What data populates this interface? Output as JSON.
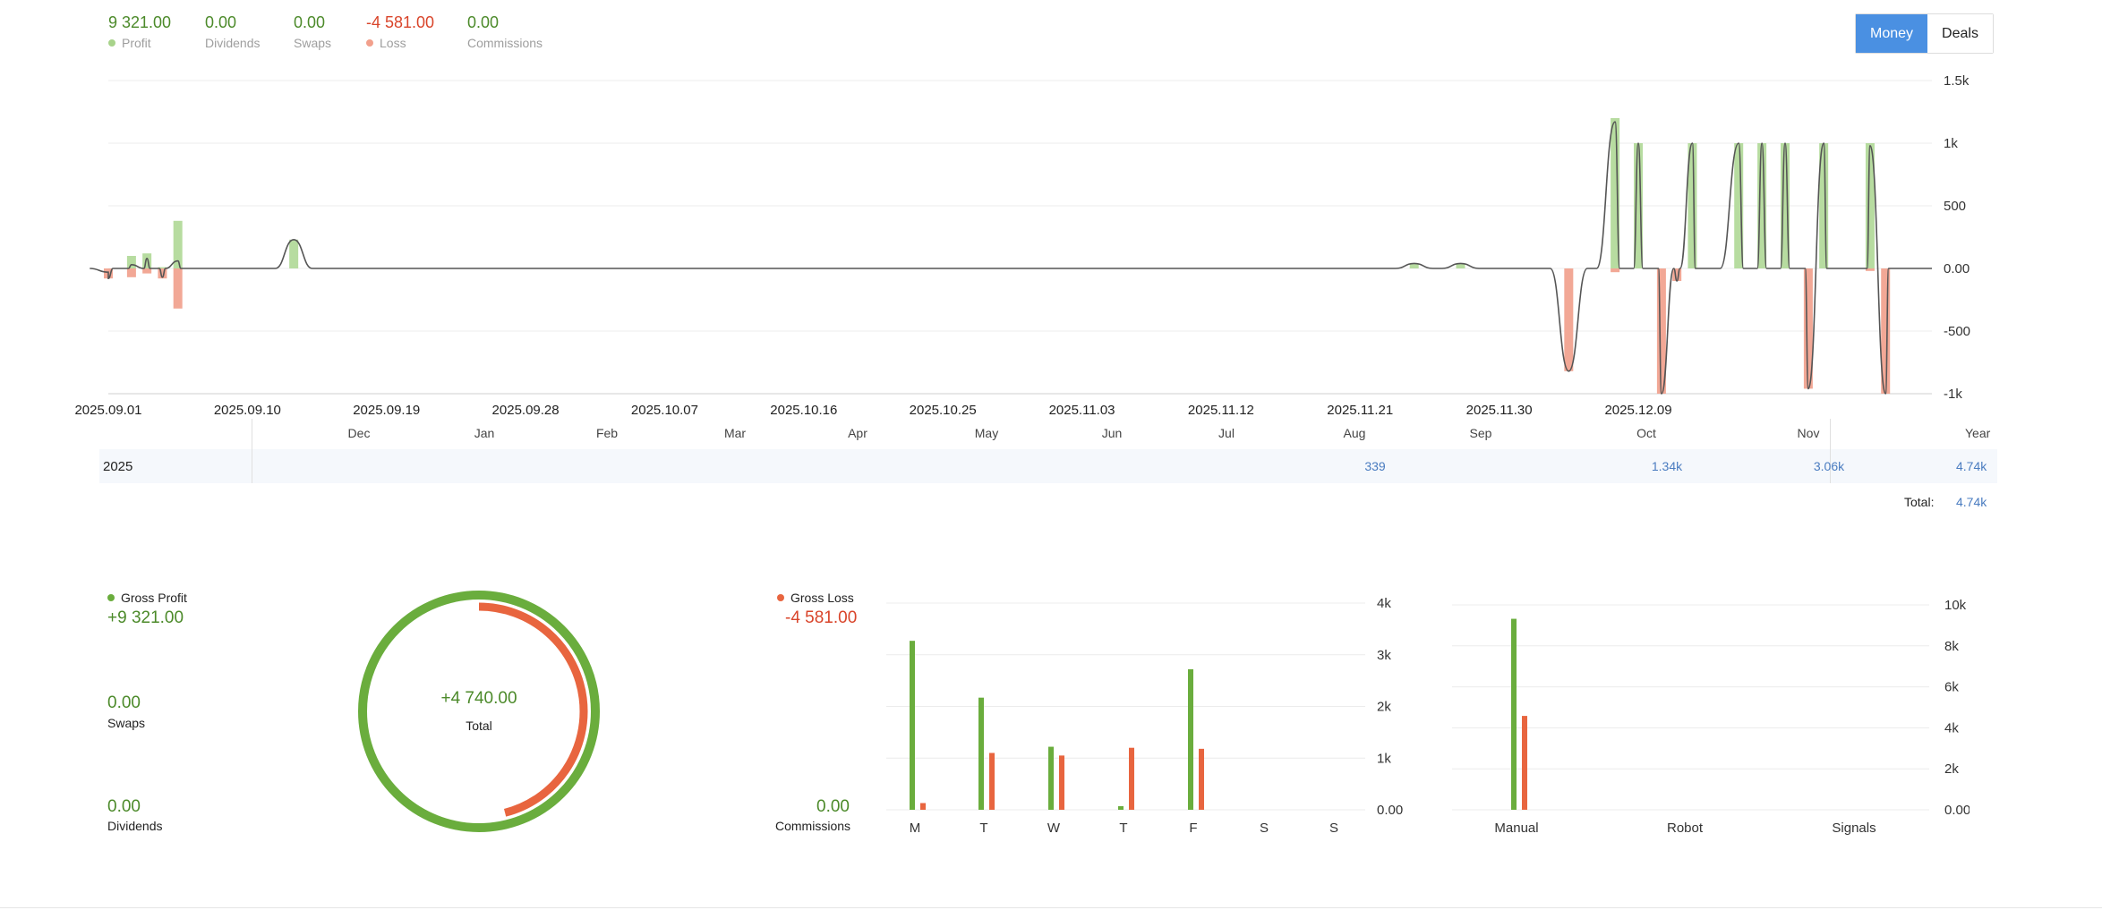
{
  "summary": [
    {
      "key": "profit",
      "value": "9 321.00",
      "label": "Profit",
      "dot": "#a8d38b",
      "color": "green"
    },
    {
      "key": "dividends",
      "value": "0.00",
      "label": "Dividends",
      "dot": "",
      "color": "green"
    },
    {
      "key": "swaps",
      "value": "0.00",
      "label": "Swaps",
      "dot": "",
      "color": "green"
    },
    {
      "key": "loss",
      "value": "-4 581.00",
      "label": "Loss",
      "dot": "#f2a08c",
      "color": "red"
    },
    {
      "key": "commissions",
      "value": "0.00",
      "label": "Commissions",
      "dot": "",
      "color": "green"
    }
  ],
  "toggle": {
    "money": "Money",
    "deals": "Deals"
  },
  "main_chart": {
    "yticks": [
      "1.5k",
      "1k",
      "500",
      "0.00",
      "-500",
      "-1k"
    ],
    "xticks": [
      "2025.09.01",
      "2025.09.10",
      "2025.09.19",
      "2025.09.28",
      "2025.10.07",
      "2025.10.16",
      "2025.10.25",
      "2025.11.03",
      "2025.11.12",
      "2025.11.21",
      "2025.11.30",
      "2025.12.09"
    ]
  },
  "months_table": {
    "headers": [
      "Dec",
      "Jan",
      "Feb",
      "Mar",
      "Apr",
      "May",
      "Jun",
      "Jul",
      "Aug",
      "Sep",
      "Oct",
      "Nov"
    ],
    "year_header": "Year",
    "row_label": "2025",
    "values": {
      "Aug": "339",
      "Oct": "1.34k",
      "Nov": "3.06k"
    },
    "year_value": "4.74k",
    "total_label": "Total:",
    "total_value": "4.74k"
  },
  "bottom": {
    "gross_profit_label": "Gross Profit",
    "gross_profit_value": "+9 321.00",
    "swaps_value": "0.00",
    "swaps_label": "Swaps",
    "dividends_value": "0.00",
    "dividends_label": "Dividends",
    "donut_value": "+4 740.00",
    "donut_label": "Total",
    "gross_loss_label": "Gross Loss",
    "gross_loss_value": "-4 581.00",
    "commissions_value": "0.00",
    "commissions_label": "Commissions"
  },
  "colors": {
    "profit": "#6aad3d",
    "loss": "#e8653f",
    "profit_light": "#b7dca0",
    "loss_light": "#f2a896",
    "accent": "#4a90e2"
  },
  "chart_data": [
    {
      "type": "bar",
      "title": "",
      "note": "daily profit/loss bars with cumulative line",
      "ylim": [
        -1000,
        1500
      ],
      "x_range": [
        "2025.09.01",
        "2025.12.09"
      ],
      "series": [
        {
          "name": "Profit",
          "values": [
            [
              0.0,
              0
            ],
            [
              1.5,
              100
            ],
            [
              2.5,
              120
            ],
            [
              3.5,
              10
            ],
            [
              4.5,
              380
            ],
            [
              12.0,
              230
            ],
            [
              84.5,
              40
            ],
            [
              87.5,
              40
            ],
            [
              94.5,
              0
            ],
            [
              97.5,
              1200
            ],
            [
              99.0,
              1000
            ],
            [
              100.5,
              0
            ],
            [
              101.5,
              0
            ],
            [
              102.5,
              1000
            ],
            [
              105.5,
              1000
            ],
            [
              107.0,
              1000
            ],
            [
              108.5,
              1000
            ],
            [
              110.0,
              0
            ],
            [
              111.0,
              1000
            ],
            [
              114.0,
              1000
            ],
            [
              115.0,
              0
            ]
          ]
        },
        {
          "name": "Loss",
          "values": [
            [
              0.0,
              -80
            ],
            [
              1.5,
              -70
            ],
            [
              2.5,
              -40
            ],
            [
              3.5,
              -80
            ],
            [
              4.5,
              -320
            ],
            [
              84.5,
              0
            ],
            [
              87.5,
              0
            ],
            [
              94.5,
              -820
            ],
            [
              97.5,
              -30
            ],
            [
              99.0,
              0
            ],
            [
              100.5,
              -1000
            ],
            [
              101.5,
              -100
            ],
            [
              102.5,
              0
            ],
            [
              105.5,
              0
            ],
            [
              107.0,
              0
            ],
            [
              108.5,
              0
            ],
            [
              110.0,
              -960
            ],
            [
              111.0,
              0
            ],
            [
              114.0,
              -20
            ],
            [
              115.0,
              -1000
            ]
          ]
        }
      ]
    },
    {
      "type": "pie",
      "note": "donut: gross profit ring vs gross loss ring",
      "values": [
        {
          "name": "Gross Profit",
          "value": 9321
        },
        {
          "name": "Gross Loss",
          "value": 4581
        }
      ]
    },
    {
      "type": "bar",
      "categories": [
        "M",
        "T",
        "W",
        "T",
        "F",
        "S",
        "S"
      ],
      "yticks": [
        "4k",
        "3k",
        "2k",
        "1k",
        "0.00"
      ],
      "ylim": [
        0,
        4000
      ],
      "series": [
        {
          "name": "Profit",
          "values": [
            3270,
            2170,
            1220,
            70,
            2720,
            0,
            0
          ]
        },
        {
          "name": "Loss",
          "values": [
            130,
            1100,
            1050,
            1200,
            1180,
            0,
            0
          ]
        }
      ]
    },
    {
      "type": "bar",
      "categories": [
        "Manual",
        "Robot",
        "Signals"
      ],
      "yticks": [
        "10k",
        "8k",
        "6k",
        "4k",
        "2k",
        "0.00"
      ],
      "ylim": [
        0,
        10000
      ],
      "series": [
        {
          "name": "Profit",
          "values": [
            9321,
            0,
            0
          ]
        },
        {
          "name": "Loss",
          "values": [
            4581,
            0,
            0
          ]
        }
      ]
    }
  ]
}
